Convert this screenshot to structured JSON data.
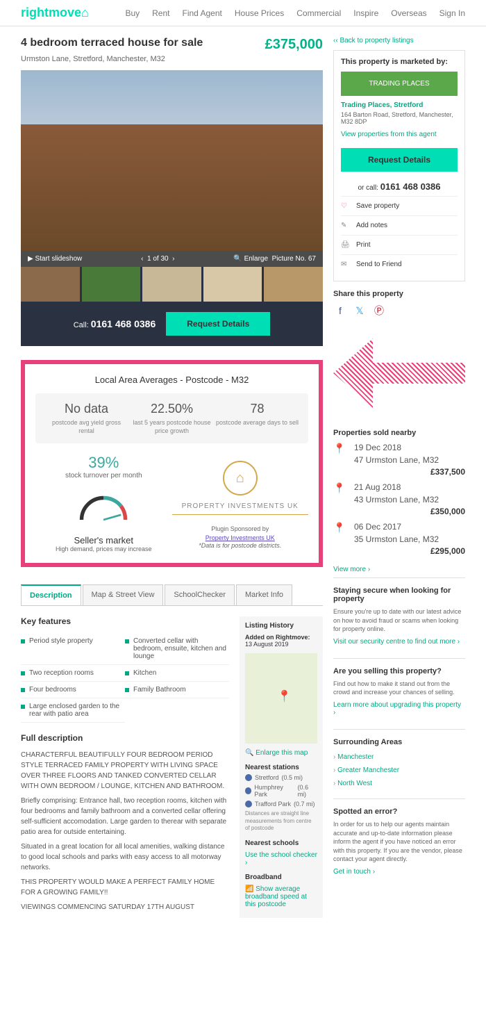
{
  "logo": "rightmove",
  "nav": [
    "Buy",
    "Rent",
    "Find Agent",
    "House Prices",
    "Commercial",
    "Inspire",
    "Overseas",
    "Sign In"
  ],
  "title": "4 bedroom terraced house for sale",
  "subtitle": "Urmston Lane, Stretford, Manchester, M32",
  "price": "£375,000",
  "slideshow": {
    "start": "Start slideshow",
    "counter": "1 of 30",
    "enlarge": "Enlarge",
    "picno": "Picture No. 67"
  },
  "callbar": {
    "call": "Call:",
    "phone": "0161 468 0386",
    "request": "Request Details"
  },
  "widget": {
    "title": "Local Area Averages - Postcode - M32",
    "stats": [
      {
        "val": "No data",
        "lbl": "postcode avg yield gross rental"
      },
      {
        "val": "22.50%",
        "lbl": "last 5 years postcode house price growth"
      },
      {
        "val": "78",
        "lbl": "postcode average days to sell"
      }
    ],
    "turnover": "39%",
    "turnover_lbl": "stock turnover per month",
    "market": "Seller's market",
    "market_sub": "High demand, prices may increase",
    "sponsor_name": "PROPERTY INVESTMENTS UK",
    "sponsor_by": "Plugin Sponsored by",
    "sponsor_link": "Property Investments UK",
    "sponsor_note": "*Data is for postcode districts."
  },
  "tabs": [
    "Description",
    "Map & Street View",
    "SchoolChecker",
    "Market Info"
  ],
  "features_title": "Key features",
  "features": [
    "Period style property",
    "Converted cellar with bedroom, ensuite, kitchen and lounge",
    "Two reception rooms",
    "Kitchen",
    "Four bedrooms",
    "Family Bathroom",
    "Large enclosed garden to the rear with patio area"
  ],
  "desc_title": "Full description",
  "desc": [
    "CHARACTERFUL BEAUTIFULLY FOUR BEDROOM PERIOD STYLE TERRACED FAMILY PROPERTY WITH LIVING SPACE OVER THREE FLOORS AND TANKED CONVERTED CELLAR WITH OWN BEDROOM / LOUNGE, KITCHEN AND BATHROOM.",
    "Briefly comprising: Entrance hall, two reception rooms, kitchen with four bedrooms and family bathroom and a converted cellar offering self-sufficient accomodation. Large garden to therear with separate patio area for outside entertaining.",
    "Situated in a great location for all local amenities, walking distance to good local schools and parks with easy access to all motorway networks.",
    "THIS PROPERTY WOULD MAKE A PERFECT FAMILY HOME FOR A GROWING FAMILY!!",
    "VIEWINGS COMMENCING SATURDAY 17TH AUGUST"
  ],
  "listing": {
    "title": "Listing History",
    "added_lbl": "Added on Rightmove:",
    "added": "13 August 2019",
    "enlarge": "Enlarge this map",
    "stations_title": "Nearest stations",
    "stations": [
      {
        "n": "Stretford",
        "d": "(0.5 mi)"
      },
      {
        "n": "Humphrey Park",
        "d": "(0.6 mi)"
      },
      {
        "n": "Trafford Park",
        "d": "(0.7 mi)"
      }
    ],
    "dist_note": "Distances are straight line measurements from centre of postcode",
    "schools_title": "Nearest schools",
    "schools_link": "Use the school checker",
    "bb_title": "Broadband",
    "bb_link": "Show average broadband speed at this postcode"
  },
  "back": "Back to property listings",
  "agent": {
    "title": "This property is marketed by:",
    "logo": "TRADING PLACES",
    "name": "Trading Places, Stretford",
    "addr": "164 Barton Road, Stretford, Manchester, M32 8DP",
    "view": "View properties from this agent",
    "request": "Request Details",
    "or": "or call:",
    "phone": "0161 468 0386"
  },
  "actions": [
    "Save property",
    "Add notes",
    "Print",
    "Send to Friend"
  ],
  "share_title": "Share this property",
  "sold": {
    "title": "Properties sold nearby",
    "items": [
      {
        "date": "19 Dec 2018",
        "addr": "47 Urmston Lane, M32",
        "price": "£337,500"
      },
      {
        "date": "21 Aug 2018",
        "addr": "43 Urmston Lane, M32",
        "price": "£350,000"
      },
      {
        "date": "06 Dec 2017",
        "addr": "35 Urmston Lane, M32",
        "price": "£295,000"
      }
    ],
    "more": "View more"
  },
  "info": [
    {
      "t": "Staying secure when looking for property",
      "d": "Ensure you're up to date with our latest advice on how to avoid fraud or scams when looking for property online.",
      "l": "Visit our security centre to find out more"
    },
    {
      "t": "Are you selling this property?",
      "d": "Find out how to make it stand out from the crowd and increase your chances of selling.",
      "l": "Learn more about upgrading this property"
    }
  ],
  "areas": {
    "title": "Surrounding Areas",
    "items": [
      "Manchester",
      "Greater Manchester",
      "North West"
    ]
  },
  "error": {
    "title": "Spotted an error?",
    "text": "In order for us to help our agents maintain accurate and up-to-date information please inform the agent if you have noticed an error with this property. If you are the vendor, please contact your agent directly.",
    "link": "Get in touch"
  }
}
